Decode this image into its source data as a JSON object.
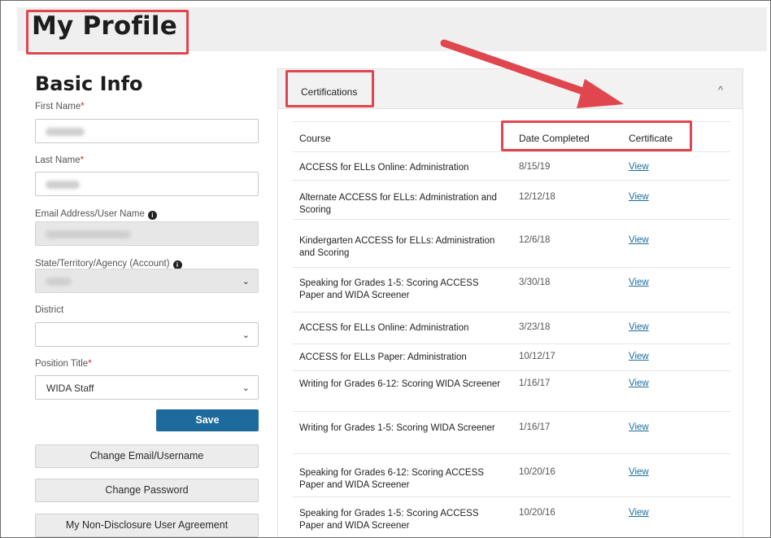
{
  "page": {
    "title": "My Profile"
  },
  "basic_info": {
    "heading": "Basic Info",
    "first_name_label": "First Name",
    "last_name_label": "Last Name",
    "email_label": "Email Address/User Name",
    "state_label": "State/Territory/Agency (Account)",
    "district_label": "District",
    "position_label": "Position Title",
    "position_value": "WIDA Staff",
    "required_mark": "*",
    "info_glyph": "i",
    "chevron": "⌄",
    "save_label": "Save",
    "change_email_label": "Change Email/Username",
    "change_password_label": "Change Password",
    "nda_label": "My Non-Disclosure User Agreement"
  },
  "certifications": {
    "title": "Certifications",
    "collapse_glyph": "^",
    "columns": {
      "course": "Course",
      "date": "Date Completed",
      "certificate": "Certificate"
    },
    "rows": [
      {
        "course": "ACCESS for ELLs Online: Administration",
        "date": "8/15/19",
        "link": "View"
      },
      {
        "course": "Alternate ACCESS for ELLs: Administration and Scoring",
        "date": "12/12/18",
        "link": "View"
      },
      {
        "course": "Kindergarten ACCESS for ELLs: Administration and Scoring",
        "date": "12/6/18",
        "link": "View"
      },
      {
        "course": "Speaking for Grades 1-5: Scoring ACCESS Paper and WIDA Screener",
        "date": "3/30/18",
        "link": "View"
      },
      {
        "course": "ACCESS for ELLs Online: Administration",
        "date": "3/23/18",
        "link": "View"
      },
      {
        "course": "ACCESS for ELLs Paper: Administration",
        "date": "10/12/17",
        "link": "View"
      },
      {
        "course": "Writing for Grades 6-12: Scoring WIDA Screener",
        "date": "1/16/17",
        "link": "View"
      },
      {
        "course": "Writing for Grades 1-5: Scoring WIDA Screener",
        "date": "1/16/17",
        "link": "View"
      },
      {
        "course": "Speaking for Grades 6-12: Scoring ACCESS Paper and WIDA Screener",
        "date": "10/20/16",
        "link": "View"
      },
      {
        "course": "Speaking for Grades 1-5: Scoring ACCESS Paper and WIDA Screener",
        "date": "10/20/16",
        "link": "View"
      }
    ]
  },
  "colors": {
    "highlight": "#e0464d",
    "accent": "#1d6b9c"
  }
}
